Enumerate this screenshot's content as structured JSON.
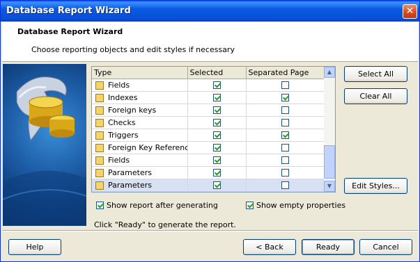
{
  "window": {
    "title": "Database Report Wizard",
    "close_icon": "close-icon"
  },
  "header": {
    "title": "Database Report Wizard",
    "subtitle": "Choose reporting objects and edit styles if necessary"
  },
  "grid": {
    "columns": [
      "Type",
      "Selected",
      "Separated Page"
    ],
    "rows": [
      {
        "icon": "table-icon",
        "type": "Fields",
        "selected": true,
        "separated": false
      },
      {
        "icon": "index-icon",
        "type": "Indexes",
        "selected": true,
        "separated": true
      },
      {
        "icon": "key-icon",
        "type": "Foreign keys",
        "selected": true,
        "separated": false
      },
      {
        "icon": "check-icon",
        "type": "Checks",
        "selected": true,
        "separated": false
      },
      {
        "icon": "trigger-icon",
        "type": "Triggers",
        "selected": true,
        "separated": true
      },
      {
        "icon": "key-icon",
        "type": "Foreign Key References",
        "selected": true,
        "separated": false
      },
      {
        "icon": "table-icon",
        "type": "Fields",
        "selected": true,
        "separated": false
      },
      {
        "icon": "parameter-icon",
        "type": "Parameters",
        "selected": true,
        "separated": false
      },
      {
        "icon": "parameter-icon",
        "type": "Parameters",
        "selected": true,
        "separated": false
      }
    ],
    "selected_row_index": 8
  },
  "buttons": {
    "select_all": "Select All",
    "clear_all": "Clear All",
    "edit_styles": "Edit Styles...",
    "help": "Help",
    "back": "< Back",
    "ready": "Ready",
    "cancel": "Cancel"
  },
  "options": {
    "show_report": {
      "label": "Show report after generating",
      "checked": true
    },
    "show_empty": {
      "label": "Show empty properties",
      "checked": true
    }
  },
  "footer_note": "Click \"Ready\" to generate the report.",
  "colors": {
    "title_bar": "#0a5ce8",
    "selected_row": "#d7e1f2",
    "check_green": "#21a121"
  }
}
